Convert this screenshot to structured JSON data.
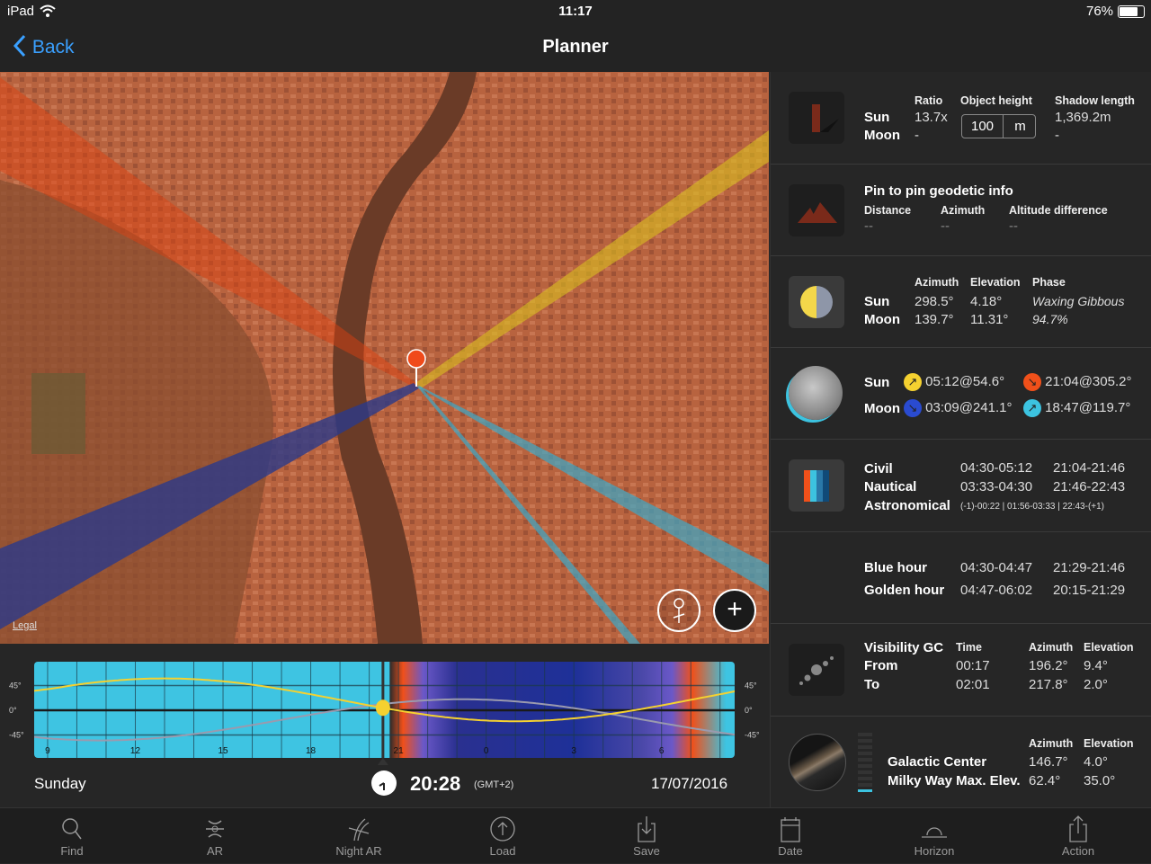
{
  "status_bar": {
    "device": "iPad",
    "time": "11:17",
    "battery": "76%",
    "battery_level": 0.76
  },
  "header": {
    "back_label": "Back",
    "title": "Planner"
  },
  "map": {
    "legal_label": "Legal",
    "pin_color": "#f04a1a"
  },
  "shadow": {
    "rows": [
      "Sun",
      "Moon"
    ],
    "ratio_label": "Ratio",
    "ratio_values": [
      "13.7x",
      "-"
    ],
    "object_height_label": "Object height",
    "object_height_value": "100",
    "object_height_unit": "m",
    "shadow_label": "Shadow length",
    "shadow_values": [
      "1,369.2m",
      "-"
    ]
  },
  "geodetic": {
    "title": "Pin to pin geodetic info",
    "distance_label": "Distance",
    "distance_value": "--",
    "azimuth_label": "Azimuth",
    "azimuth_value": "--",
    "altitude_label": "Altitude difference",
    "altitude_value": "--"
  },
  "position": {
    "rows": [
      "Sun",
      "Moon"
    ],
    "azimuth_label": "Azimuth",
    "elevation_label": "Elevation",
    "phase_label": "Phase",
    "sun_azimuth": "298.5°",
    "sun_elevation": "4.18°",
    "moon_azimuth": "139.7°",
    "moon_elevation": "11.31°",
    "phase_name": "Waxing Gibbous",
    "phase_percent": "94.7%"
  },
  "rise_set": {
    "sun_label": "Sun",
    "moon_label": "Moon",
    "sun_rise": "05:12@54.6°",
    "sun_set": "21:04@305.2°",
    "moon_set": "03:09@241.1°",
    "moon_rise": "18:47@119.7°",
    "colors": {
      "sun_rise": "#f5d130",
      "sun_set": "#f0501a",
      "moon_set": "#2a4bd0",
      "moon_rise": "#3cc3e0"
    }
  },
  "twilight": {
    "civil_label": "Civil",
    "civil_am": "04:30-05:12",
    "civil_pm": "21:04-21:46",
    "nautical_label": "Nautical",
    "nautical_am": "03:33-04:30",
    "nautical_pm": "21:46-22:43",
    "astro_label": "Astronomical",
    "astro_value": "(-1)-00:22 | 01:56-03:33 | 22:43-(+1)"
  },
  "hours": {
    "blue_label": "Blue hour",
    "blue_am": "04:30-04:47",
    "blue_pm": "21:29-21:46",
    "golden_label": "Golden hour",
    "golden_am": "04:47-06:02",
    "golden_pm": "20:15-21:29"
  },
  "visibility_gc": {
    "title": "Visibility GC",
    "time_label": "Time",
    "azimuth_label": "Azimuth",
    "elevation_label": "Elevation",
    "from_label": "From",
    "from_time": "00:17",
    "from_azimuth": "196.2°",
    "from_elevation": "9.4°",
    "to_label": "To",
    "to_time": "02:01",
    "to_azimuth": "217.8°",
    "to_elevation": "2.0°"
  },
  "galactic": {
    "azimuth_label": "Azimuth",
    "elevation_label": "Elevation",
    "gc_label": "Galactic Center",
    "gc_azimuth": "146.7°",
    "gc_elevation": "4.0°",
    "mw_label": "Milky Way Max. Elev.",
    "mw_azimuth": "62.4°",
    "mw_elevation": "35.0°",
    "level": 0.1
  },
  "timeline": {
    "day": "Sunday",
    "time": "20:28",
    "timezone": "(GMT+2)",
    "date": "17/07/2016"
  },
  "chart_data": {
    "type": "line",
    "x_ticks": [
      "9",
      "12",
      "15",
      "18",
      "21",
      "0",
      "3",
      "6"
    ],
    "y_ticks": [
      "45°",
      "0°",
      "-45°"
    ],
    "xlim": [
      8.54,
      32.5
    ],
    "ylim": [
      -75,
      80
    ],
    "current_hour": 20.47,
    "hours": [
      8,
      9,
      10,
      11,
      12,
      13,
      14,
      15,
      16,
      17,
      18,
      19,
      20,
      21,
      22,
      23,
      24,
      25,
      26,
      27,
      28,
      29,
      30,
      31,
      32,
      33
    ],
    "series": [
      {
        "color": "#f5d130",
        "values": [
          33,
          38.5,
          46.6,
          52.8,
          56.7,
          58,
          56.7,
          52.8,
          46.6,
          38.5,
          29.1,
          19,
          8.9,
          -0.5,
          -8.6,
          -14.8,
          -18.7,
          -20,
          -18.7,
          -14.8,
          -8.6,
          -0.5,
          8.9,
          19,
          29.1,
          38.5
        ]
      },
      {
        "color": "#9a9aae",
        "values": [
          -45.9,
          -51.1,
          -54.2,
          -55,
          -53.3,
          -49.3,
          -43.4,
          -35.7,
          -26.9,
          -17.5,
          -8.1,
          0.7,
          8.3,
          14.3,
          18.3,
          20,
          19.2,
          16.2,
          10.9,
          3.9,
          -4.5,
          -13.7,
          -23.2,
          -32.3,
          -40.5,
          -47.2
        ]
      }
    ]
  },
  "tabs": [
    {
      "label": "Find",
      "icon": "search-icon"
    },
    {
      "label": "AR",
      "icon": "ar-icon"
    },
    {
      "label": "Night AR",
      "icon": "night-ar-icon"
    },
    {
      "label": "Load",
      "icon": "load-icon"
    },
    {
      "label": "Save",
      "icon": "save-icon"
    },
    {
      "label": "Date",
      "icon": "date-icon"
    },
    {
      "label": "Horizon",
      "icon": "horizon-icon"
    },
    {
      "label": "Action",
      "icon": "action-icon"
    }
  ]
}
